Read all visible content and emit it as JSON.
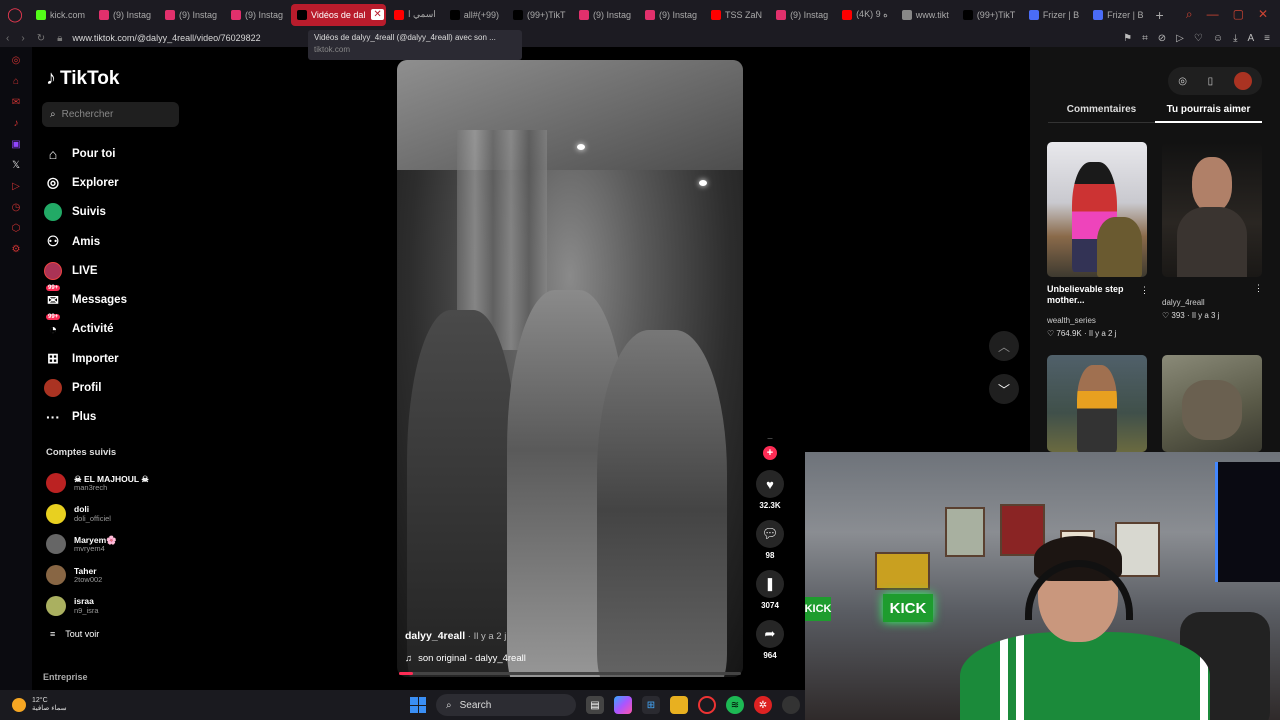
{
  "browser": {
    "tabs": [
      {
        "label": "kick.com",
        "color": "#53fc18",
        "active": false
      },
      {
        "label": "(9) Instag",
        "color": "#e1306c",
        "active": false
      },
      {
        "label": "(9) Instag",
        "color": "#e1306c",
        "active": false
      },
      {
        "label": "(9) Instag",
        "color": "#e1306c",
        "active": false
      },
      {
        "label": "Vidéos de dal",
        "color": "#000000",
        "active": true
      },
      {
        "label": "اسمي ا",
        "color": "#ff0000",
        "active": false
      },
      {
        "label": "all#(+99)",
        "color": "#000000",
        "active": false
      },
      {
        "label": "(99+)TikT",
        "color": "#000000",
        "active": false
      },
      {
        "label": "(9) Instag",
        "color": "#e1306c",
        "active": false
      },
      {
        "label": "(9) Instag",
        "color": "#e1306c",
        "active": false
      },
      {
        "label": "TSS ZaN",
        "color": "#ff0000",
        "active": false
      },
      {
        "label": "(9) Instag",
        "color": "#e1306c",
        "active": false
      },
      {
        "label": "(4K) 9 ه",
        "color": "#ff0000",
        "active": false
      },
      {
        "label": "www.tikt",
        "color": "#888888",
        "active": false
      },
      {
        "label": "(99+)TikT",
        "color": "#000000",
        "active": false
      },
      {
        "label": "Frizer | B",
        "color": "#4a6cf7",
        "active": false
      },
      {
        "label": "Frizer | B",
        "color": "#4a6cf7",
        "active": false
      }
    ],
    "newtab_glyph": "+",
    "url": "www.tiktok.com/@dalyy_4reall/video/76029822",
    "tooltip_title": "Vidéos de dalyy_4reall (@dalyy_4reall) avec son ...",
    "tooltip_domain": "tiktok.com"
  },
  "tiktok": {
    "logo_text": "TikTok",
    "search_placeholder": "Rechercher",
    "nav": [
      {
        "label": "Pour toi",
        "icon": "home-icon",
        "glyph": "⌂"
      },
      {
        "label": "Explorer",
        "icon": "compass-icon",
        "glyph": "◎"
      },
      {
        "label": "Suivis",
        "icon": "following-icon",
        "glyph": ""
      },
      {
        "label": "Amis",
        "icon": "friends-icon",
        "glyph": "⚇"
      },
      {
        "label": "LIVE",
        "icon": "live-icon",
        "glyph": ""
      },
      {
        "label": "Messages",
        "icon": "messages-icon",
        "glyph": "✉",
        "badge": "99+"
      },
      {
        "label": "Activité",
        "icon": "activity-icon",
        "glyph": "◔",
        "badge": "99+"
      },
      {
        "label": "Importer",
        "icon": "upload-icon",
        "glyph": "⊞"
      },
      {
        "label": "Profil",
        "icon": "profile-icon",
        "glyph": ""
      },
      {
        "label": "Plus",
        "icon": "more-icon",
        "glyph": "···"
      }
    ],
    "following_title": "Comptes suivis",
    "following": [
      {
        "name": "☠ EL MAJHOUL ☠",
        "handle": "man3rech",
        "color": "#b22"
      },
      {
        "name": "doli",
        "handle": "doli_officiel",
        "color": "#e8d020"
      },
      {
        "name": "Maryem🌸",
        "handle": "mvryem4",
        "color": "#666"
      },
      {
        "name": "Taher",
        "handle": "2tow002",
        "color": "#886644"
      },
      {
        "name": "israa",
        "handle": "n9_isra",
        "color": "#aab060"
      }
    ],
    "see_all": "Tout voir",
    "enterprise": "Entreprise"
  },
  "video": {
    "author": "dalyy_4reall",
    "ago": " · Il y a 2 j",
    "sound": "son original - dalyy_4reall",
    "progress": 0.04,
    "likes": "32.3K",
    "comments": "98",
    "saves": "3074",
    "shares": "964"
  },
  "right_panel": {
    "tabs": [
      "Commentaires",
      "Tu pourrais aimer"
    ],
    "active_tab": 1,
    "cards": [
      {
        "caption": "Unbelievable step mother...",
        "author": "wealth_series",
        "likes": "764.9K",
        "ago": "Il y a 2 j"
      },
      {
        "caption": "",
        "author": "dalyy_4reall",
        "likes": "393",
        "ago": "Il y a 3 j"
      }
    ]
  },
  "webcam": {
    "sign": "KICK",
    "sign_small": "KICK"
  },
  "taskbar": {
    "temp": "12°C",
    "condition": "سماء صافية",
    "search_label": "Search"
  }
}
